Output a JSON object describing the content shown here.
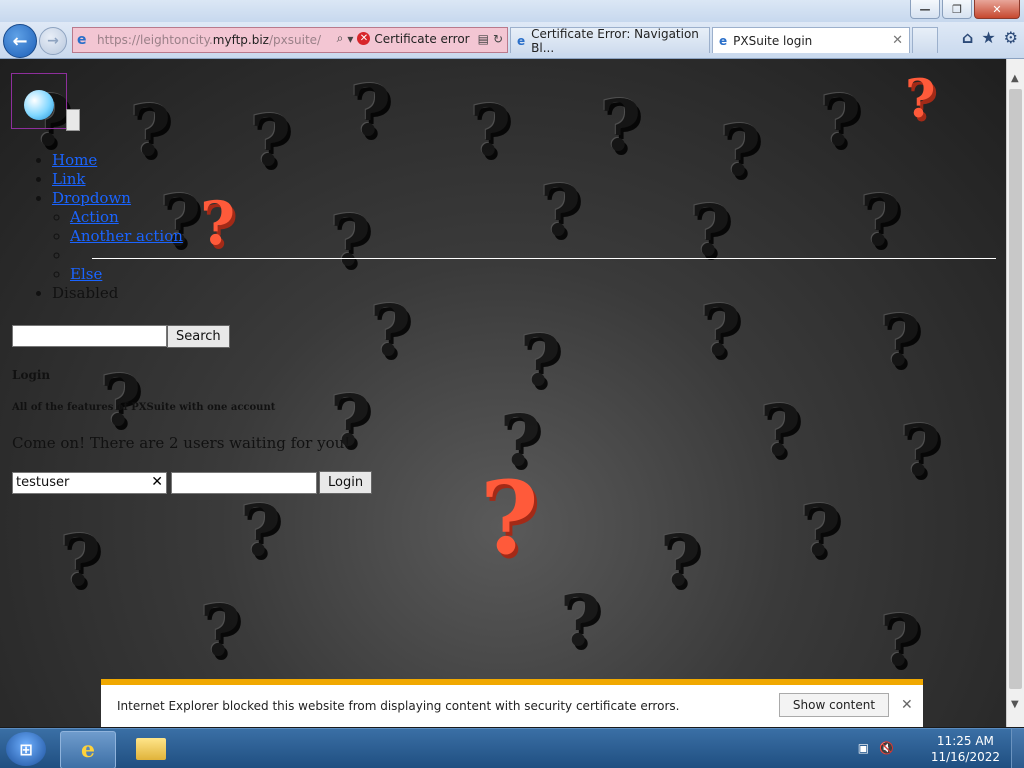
{
  "window": {
    "minimize": "—",
    "maximize": "❐",
    "close": "✕"
  },
  "browser": {
    "url_pre": "https://leightoncity.",
    "url_host": "myftp.biz",
    "url_post": "/pxsuite/",
    "cert_error": "Certificate error",
    "tabs": [
      {
        "title": "Certificate Error: Navigation Bl..."
      },
      {
        "title": "PXSuite login"
      }
    ]
  },
  "page": {
    "menu": {
      "home": "Home",
      "link": "Link",
      "dropdown": "Dropdown",
      "action": "Action",
      "another_action": "Another action",
      "else_here": "Else",
      "disabled": "Disabled"
    },
    "search": {
      "value": "",
      "button": "Search"
    },
    "login": {
      "title": "Login",
      "subtitle": "All of the features of PXSuite with one account",
      "message": "Come on! There are 2 users waiting for you!",
      "username": "testuser",
      "password": "",
      "button": "Login"
    }
  },
  "notification": {
    "text": "Internet Explorer blocked this website from displaying content with security certificate errors.",
    "button": "Show content"
  },
  "taskbar": {
    "time": "11:25 AM",
    "date": "11/16/2022"
  },
  "colors": {
    "accent_red": "#ff5a3a",
    "link_blue": "#1a64ff",
    "notification_bar": "#f0a800"
  }
}
